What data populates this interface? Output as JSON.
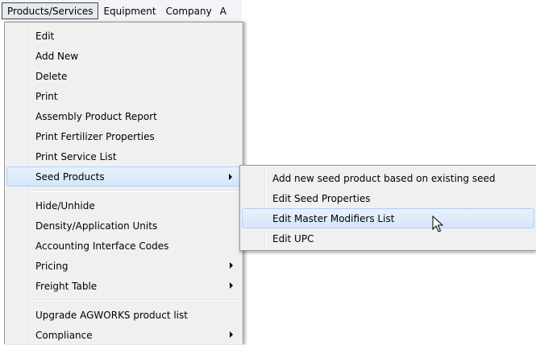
{
  "menubar": {
    "items": [
      "Products/Services",
      "Equipment",
      "Company",
      "A"
    ]
  },
  "products_menu": {
    "items": [
      {
        "label": "Edit"
      },
      {
        "label": "Add New"
      },
      {
        "label": "Delete"
      },
      {
        "label": "Print"
      },
      {
        "label": "Assembly Product Report"
      },
      {
        "label": "Print Fertilizer Properties"
      },
      {
        "label": "Print Service List"
      },
      {
        "label": "Seed Products"
      },
      {
        "label": "Hide/Unhide"
      },
      {
        "label": "Density/Application Units"
      },
      {
        "label": "Accounting Interface Codes"
      },
      {
        "label": "Pricing"
      },
      {
        "label": "Freight Table"
      },
      {
        "label": "Upgrade AGWORKS product list"
      },
      {
        "label": "Compliance"
      }
    ]
  },
  "seed_products_submenu": {
    "items": [
      {
        "label": "Add new seed product based on existing seed"
      },
      {
        "label": "Edit Seed Properties"
      },
      {
        "label": "Edit Master Modifiers List"
      },
      {
        "label": "Edit UPC"
      }
    ]
  },
  "icons": {
    "submenu_arrow": "chevron-right-icon",
    "cursor": "mouse-pointer-icon"
  },
  "colors": {
    "highlight_fill": "#d9e8fa",
    "highlight_border": "#aecff7",
    "menu_background": "#f0f0f0",
    "menu_border": "#979797"
  }
}
